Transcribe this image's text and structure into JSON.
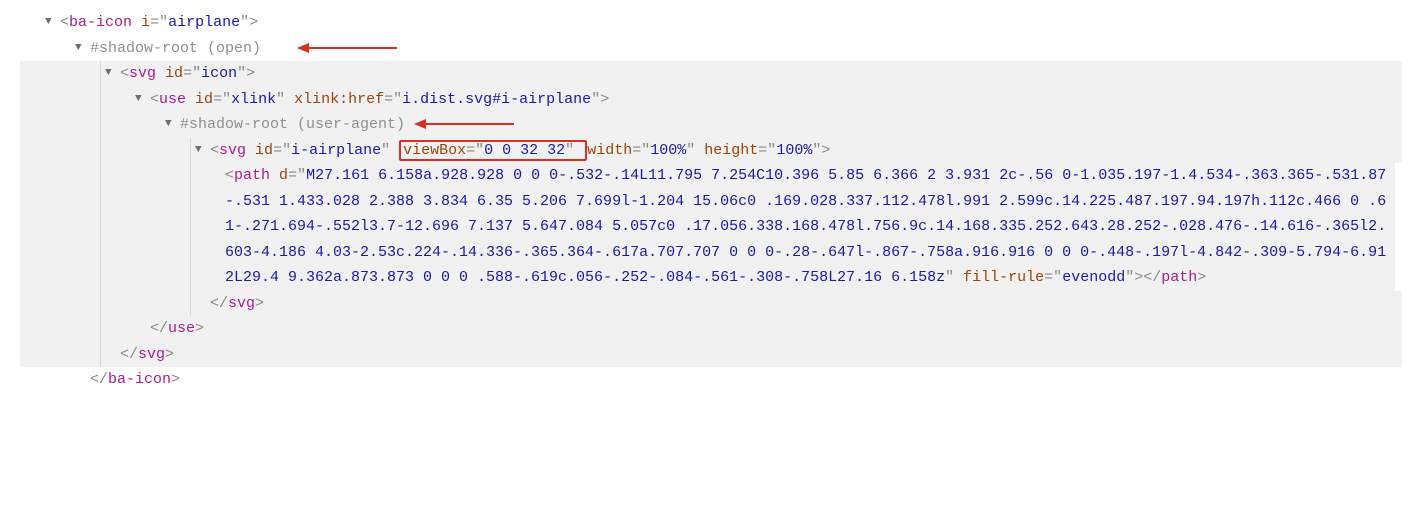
{
  "tree": {
    "baIcon": {
      "tag": "ba-icon",
      "attr_i": "i",
      "val_i": "airplane"
    },
    "shadowOpen": "#shadow-root (open)",
    "svgIcon": {
      "tag": "svg",
      "attr_id": "id",
      "val_id": "icon"
    },
    "use": {
      "tag": "use",
      "attr_id": "id",
      "val_id": "xlink",
      "attr_href": "xlink:href",
      "val_href": "i.dist.svg#i-airplane"
    },
    "shadowUA": "#shadow-root (user-agent)",
    "svgAirplane": {
      "tag": "svg",
      "attr_id": "id",
      "val_id": "i-airplane",
      "attr_viewBox": "viewBox",
      "val_viewBox": "0 0 32 32",
      "attr_width": "width",
      "val_width": "100%",
      "attr_height": "height",
      "val_height": "100%"
    },
    "path": {
      "tag": "path",
      "attr_d": "d",
      "val_d": "M27.161 6.158a.928.928 0 0 0-.532-.14L11.795 7.254C10.396 5.85 6.366 2 3.931 2c-.56 0-1.035.197-1.4.534-.363.365-.531.87-.531 1.433.028 2.388 3.834 6.35 5.206 7.699l-1.204 15.06c0 .169.028.337.112.478l.991 2.599c.14.225.487.197.94.197h.112c.466 0 .61-.271.694-.552l3.7-12.696 7.137 5.647.084 5.057c0 .17.056.338.168.478l.756.9c.14.168.335.252.643.28.252-.028.476-.14.616-.365l2.603-4.186 4.03-2.53c.224-.14.336-.365.364-.617a.707.707 0 0 0-.28-.647l-.867-.758a.916.916 0 0 0-.448-.197l-4.842-.309-5.794-6.912L29.4 9.362a.873.873 0 0 0 .588-.619c.056-.252-.084-.561-.308-.758L27.16 6.158z",
      "attr_fill": "fill-rule",
      "val_fill": "evenodd"
    },
    "close": {
      "svg": "svg",
      "use": "use",
      "path": "path",
      "baIcon": "ba-icon"
    }
  }
}
